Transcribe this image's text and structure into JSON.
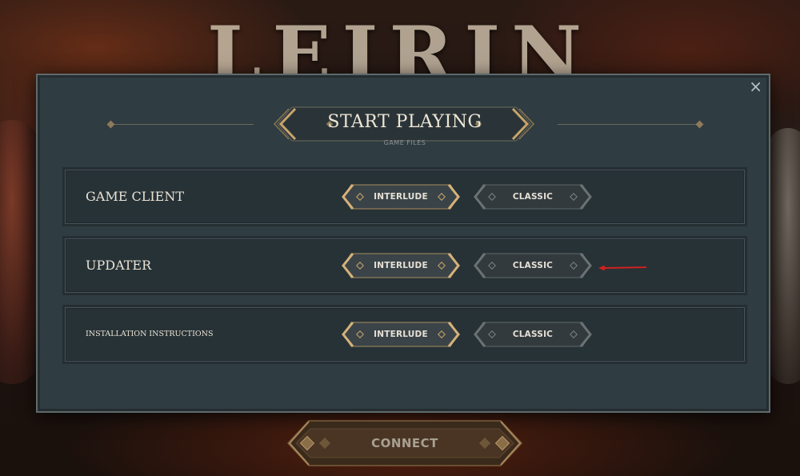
{
  "logo_text": "LEIRIN",
  "modal": {
    "title": "START PLAYING",
    "subtitle": "GAME FILES",
    "close_glyph": "×"
  },
  "rows": [
    {
      "label": "GAME CLIENT",
      "interlude": "INTERLUDE",
      "classic": "CLASSIC"
    },
    {
      "label": "UPDATER",
      "interlude": "INTERLUDE",
      "classic": "CLASSIC"
    },
    {
      "label": "INSTALLATION INSTRUCTIONS",
      "interlude": "INTERLUDE",
      "classic": "CLASSIC"
    }
  ],
  "connect_label": "CONNECT",
  "colors": {
    "gold_accent": "#c9a46a",
    "modal_bg": "#2f3c41",
    "annotation_arrow": "#d42020"
  },
  "icons": [
    "close-icon",
    "diamond-icon",
    "arrow-annotation"
  ]
}
